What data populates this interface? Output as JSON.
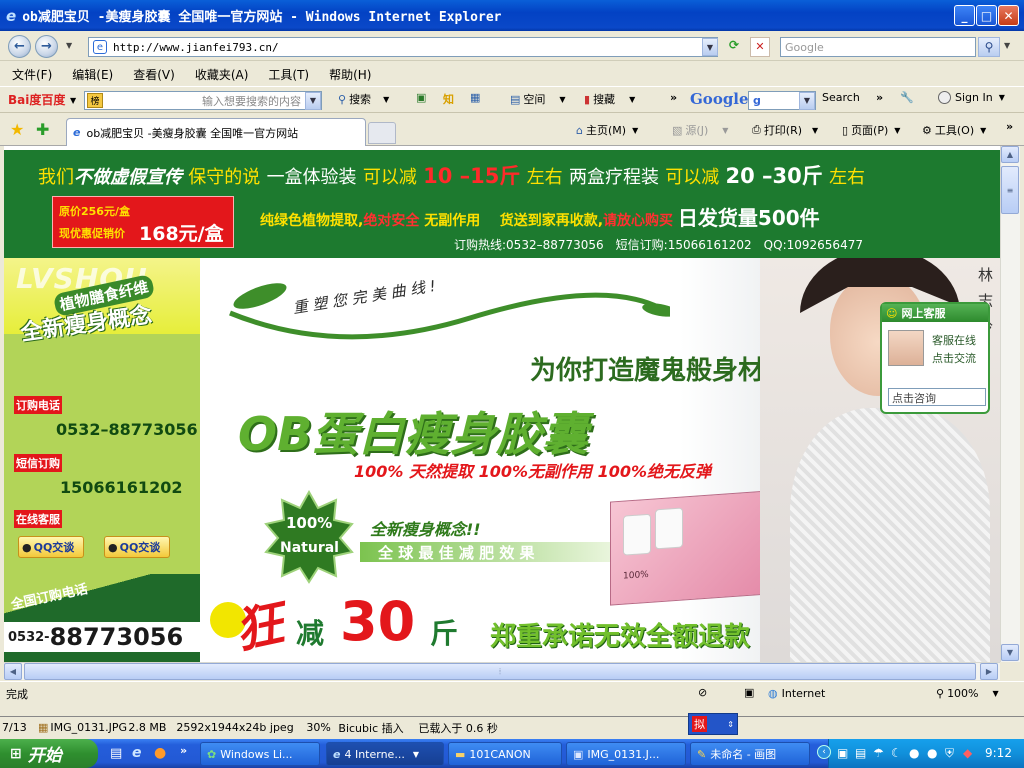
{
  "window": {
    "title": "ob减肥宝贝 -美瘦身胶囊 全国唯一官方网站 - Windows Internet Explorer"
  },
  "address": {
    "url": "http://www.jianfei793.cn/",
    "search_placeholder": "Google"
  },
  "menu": [
    "文件(F)",
    "编辑(E)",
    "查看(V)",
    "收藏夹(A)",
    "工具(T)",
    "帮助(H)"
  ],
  "toolbar": {
    "baidu_logo": "Bai度百度",
    "baidu_placeholder": "输入想要搜索的内容",
    "search_label": "搜索",
    "kongjian_label": "空间",
    "soucang_label": "搜藏",
    "google_logo": "Google",
    "google_search_label": "Search",
    "signin_label": "Sign In"
  },
  "tabs": {
    "active_tab": "ob减肥宝贝 -美瘦身胶囊 全国唯一官方网站",
    "home_label": "主页(M)",
    "feeds_label": "源(J)",
    "print_label": "打印(R)",
    "page_label": "页面(P)",
    "tools_label": "工具(O)"
  },
  "banner": {
    "line1_a": "我们",
    "line1_b": "不做虚假宣传",
    "line1_c": "保守的说",
    "line1_d": "一盒体验装",
    "line1_e": "可以减",
    "line1_f": "10 –15斤",
    "line1_g": "左右",
    "line1_h": "两盒疗程装",
    "line1_i": "可以减",
    "line1_j": "20 –30斤",
    "line1_k": "左右",
    "price_orig": "原价256元/盒",
    "price_promo_label": "现优惠促销价",
    "price_promo": "168元/盒",
    "line2_a": "纯绿色植物提取,",
    "line2_b": "绝对安全",
    "line2_c": "无副作用",
    "line2_d": "货送到家再收款,",
    "line2_e": "请放心购买",
    "line2_f": "日发货量",
    "line2_g": "500件",
    "hotline": "订购热线:0532–88773056　短信订购:15066161202　QQ:1092656477"
  },
  "sidebar": {
    "logo": "LVSHOU",
    "concept_small": "植物膳食纤维",
    "concept_big": "全新瘦身概念",
    "phone_label": "订购电话",
    "phone": "0532–88773056",
    "sms_label": "短信订购",
    "sms": "15066161202",
    "service_label": "在线客服",
    "qq1": "QQ交谈",
    "qq2": "QQ交谈",
    "national_label": "全国订购电话",
    "national_prefix": "0532-",
    "national_number": "88773056"
  },
  "hero": {
    "slogan": "重 塑 您 完 美 曲 线 !",
    "tagline": "为你打造魔鬼般身材",
    "product": "OB蛋白瘦身胶囊",
    "claims": "100% 天然提取  100%无副作用  100%绝无反弹",
    "badge_pct": "100%",
    "badge_word": "Natural",
    "concept": "全新瘦身概念!!",
    "best": "全 球 最 佳 减 肥 效 果",
    "crazy": "狂",
    "lose": "减",
    "thirty": "30",
    "jin": "斤",
    "promise": "郑重承诺无效全额退款",
    "side_chars": "林\n志\n玲",
    "pack_pct": "100%"
  },
  "chat": {
    "title": "网上客服",
    "status1": "客服在线",
    "status2": "点击交流",
    "input_placeholder": "点击咨询"
  },
  "status": {
    "left": "完成",
    "zone": "Internet",
    "zoom": "100%"
  },
  "viewer": {
    "counter": "7/13",
    "file": "IMG_0131.JPG",
    "size": "2.8 MB",
    "dims": "2592x1944x24b jpeg",
    "zoom": "30%",
    "mode": "Bicubic 插入",
    "loaded": "已载入于 0.6 秒"
  },
  "taskbar": {
    "start": "开始",
    "items": [
      "Windows Li...",
      "4 Interne...",
      "101CANON",
      "IMG_0131.J...",
      "未命名 - 画图"
    ],
    "clock": "9:12",
    "ime": "拟"
  },
  "colors": {
    "banner_green": "#1d7a2f",
    "price_red": "#e3171b",
    "accent_yellow": "#ffe000"
  }
}
